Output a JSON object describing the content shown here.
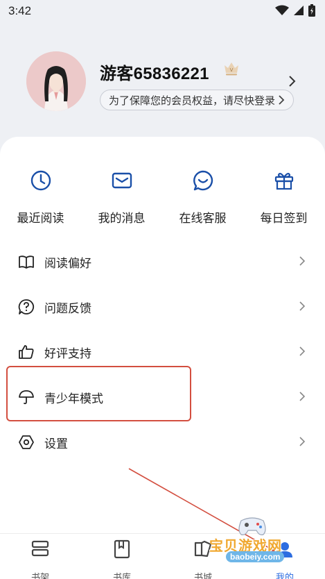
{
  "status_bar": {
    "time": "3:42",
    "icons": [
      "wifi-icon",
      "signal-icon",
      "battery-icon"
    ]
  },
  "profile": {
    "username": "游客65836221",
    "login_tip": "为了保障您的会员权益，请尽快登录"
  },
  "quick_actions": [
    {
      "icon": "clock-icon",
      "label": "最近阅读"
    },
    {
      "icon": "mail-icon",
      "label": "我的消息"
    },
    {
      "icon": "chat-icon",
      "label": "在线客服"
    },
    {
      "icon": "gift-icon",
      "label": "每日签到"
    }
  ],
  "menu": [
    {
      "icon": "book-icon",
      "label": "阅读偏好"
    },
    {
      "icon": "question-icon",
      "label": "问题反馈"
    },
    {
      "icon": "thumbs-up-icon",
      "label": "好评支持"
    },
    {
      "icon": "umbrella-icon",
      "label": "青少年模式"
    },
    {
      "icon": "settings-icon",
      "label": "设置"
    }
  ],
  "tabs": [
    {
      "icon": "bookshelf-icon",
      "label": "书架"
    },
    {
      "icon": "library-icon",
      "label": "书库"
    },
    {
      "icon": "bookstore-icon",
      "label": "书城"
    },
    {
      "icon": "me-icon",
      "label": "我的",
      "active": true
    }
  ],
  "watermark": {
    "title": "宝贝游戏网",
    "url": "baobeiy.com"
  },
  "colors": {
    "accent": "#2d6de0",
    "highlight": "#d34e3f",
    "card": "#ffffff",
    "background": "#eef0f4"
  }
}
